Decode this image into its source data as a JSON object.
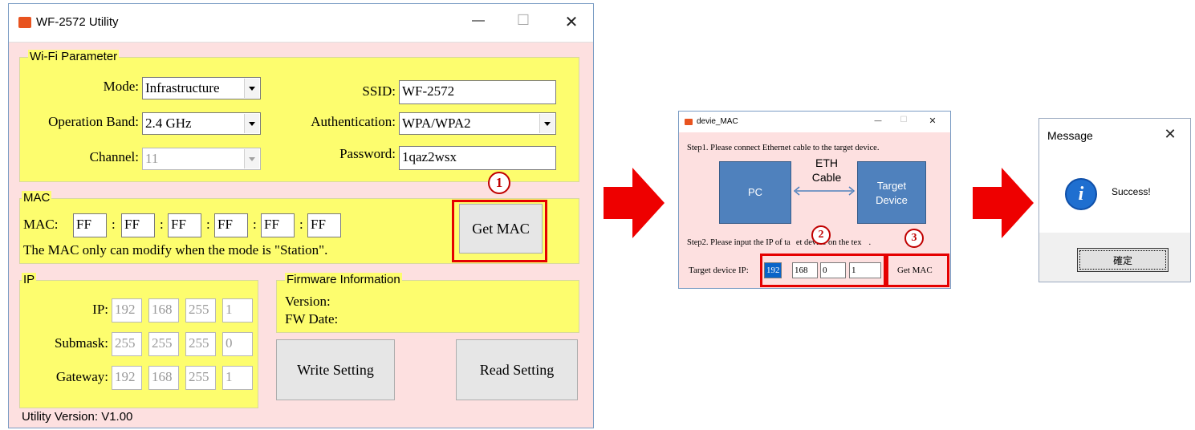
{
  "main_window": {
    "title": "WF-2572 Utility",
    "minimize": "—",
    "maximize": "☐",
    "close": "✕",
    "wifi_group": {
      "label": "Wi-Fi Parameter",
      "mode_label": "Mode:",
      "mode_value": "Infrastructure",
      "band_label": "Operation Band:",
      "band_value": "2.4 GHz",
      "channel_label": "Channel:",
      "channel_value": "11",
      "ssid_label": "SSID:",
      "ssid_value": "WF-2572",
      "auth_label": "Authentication:",
      "auth_value": "WPA/WPA2",
      "password_label": "Password:",
      "password_value": "1qaz2wsx"
    },
    "mac_group": {
      "label": "MAC",
      "mac_label": "MAC:",
      "octets": [
        "FF",
        "FF",
        "FF",
        "FF",
        "FF",
        "FF"
      ],
      "separator": ":",
      "note": "The MAC only can modify when the mode is \"Station\".",
      "get_mac_button": "Get MAC",
      "step_badge": "1"
    },
    "ip_group": {
      "label": "IP",
      "ip_label": "IP:",
      "ip": [
        "192",
        "168",
        "255",
        "1"
      ],
      "submask_label": "Submask:",
      "submask": [
        "255",
        "255",
        "255",
        "0"
      ],
      "gateway_label": "Gateway:",
      "gateway": [
        "192",
        "168",
        "255",
        "1"
      ]
    },
    "fw_group": {
      "label": "Firmware Information",
      "version_label": "Version:",
      "fwdate_label": "FW Date:"
    },
    "write_button": "Write Setting",
    "read_button": "Read Setting",
    "utility_version": "Utility Version: V1.00"
  },
  "mac_window": {
    "title": "devie_MAC",
    "minimize": "—",
    "maximize": "☐",
    "close": "✕",
    "step1": "Step1. Please connect Ethernet cable to the target device.",
    "pc_label": "PC",
    "cable_label_1": "ETH",
    "cable_label_2": "Cable",
    "target_label_1": "Target",
    "target_label_2": "Device",
    "step2_a": "Step2. Please input the IP of ",
    "step2_b": "ta",
    "step2_c": "et device on the tex",
    "step2_d": ".",
    "target_ip_label": "Target device IP:",
    "ip": [
      "192",
      "168",
      "0",
      "1"
    ],
    "get_mac_button": "Get MAC",
    "step_badge_2": "2",
    "step_badge_3": "3"
  },
  "message_window": {
    "title": "Message",
    "close": "✕",
    "info_icon_glyph": "i",
    "text": "Success!",
    "ok_button": "確定"
  },
  "colors": {
    "pink_bg": "#fde0e0",
    "group_yellow": "#fdfd6e",
    "highlight_red": "#e50000",
    "flow_arrow_red": "#ee0000",
    "diagram_blue": "#4f81bd"
  }
}
